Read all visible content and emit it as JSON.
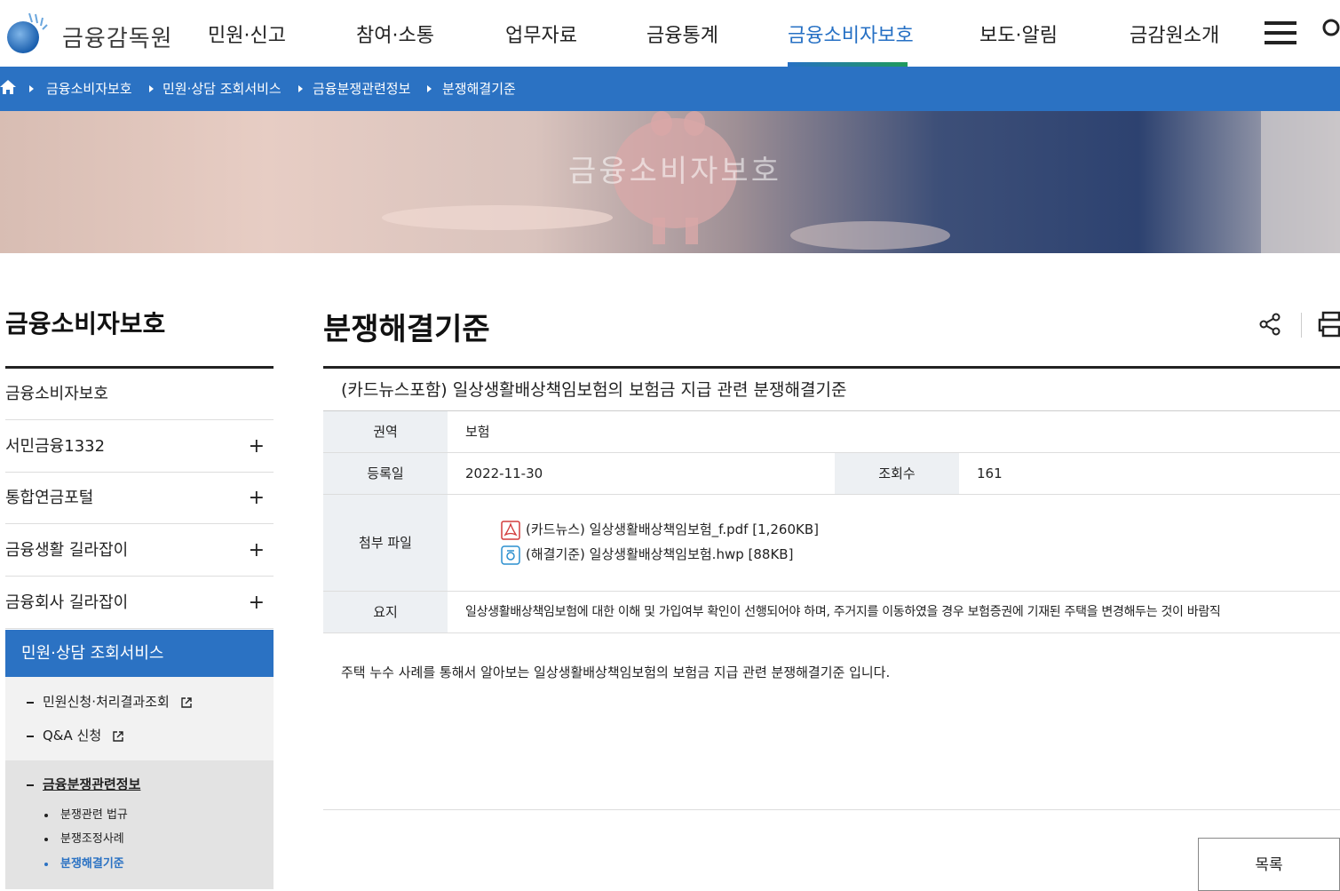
{
  "header": {
    "logo_text": "금융감독원",
    "nav": [
      "민원·신고",
      "참여·소통",
      "업무자료",
      "금융통계",
      "금융소비자보호",
      "보도·알림",
      "금감원소개"
    ],
    "active_nav": "금융소비자보호",
    "accent_color": "#2b72c3"
  },
  "breadcrumb": [
    "금융소비자보호",
    "민원·상담 조회서비스",
    "금융분쟁관련정보",
    "분쟁해결기준"
  ],
  "banner": {
    "title": "금융소비자보호"
  },
  "lnb": {
    "title": "금융소비자보호",
    "items": [
      {
        "label": "금융소비자보호",
        "expand": ""
      },
      {
        "label": "서민금융1332",
        "expand": "+"
      },
      {
        "label": "통합연금포털",
        "expand": "+"
      },
      {
        "label": "금융생활 길라잡이",
        "expand": "+"
      },
      {
        "label": "금융회사 길라잡이",
        "expand": "+"
      }
    ],
    "active": "민원·상담 조회서비스",
    "sub_links": [
      "민원신청·처리결과조회",
      "Q&A 신청"
    ],
    "sub_section": "금융분쟁관련정보",
    "sub_section_items": [
      "분쟁관련 법규",
      "분쟁조정사례",
      "분쟁해결기준"
    ],
    "current_item": "분쟁해결기준"
  },
  "content": {
    "page_title": "분쟁해결기준",
    "post_title": "(카드뉴스포함) 일상생활배상책임보험의 보험금 지급 관련 분쟁해결기준",
    "labels": {
      "category": "권역",
      "date": "등록일",
      "views": "조회수",
      "attachments": "첨부 파일",
      "summary": "요지"
    },
    "category": "보험",
    "date": "2022-11-30",
    "views": "161",
    "files": [
      {
        "name": "(카드뉴스) 일상생활배상책임보험_f.pdf [1,260KB]",
        "icon": "pdf-icon"
      },
      {
        "name": "(해결기준) 일상생활배상책임보험.hwp [88KB]",
        "icon": "hwp-icon"
      }
    ],
    "summary": "일상생활배상책임보험에 대한 이해 및 가입여부 확인이 선행되어야 하며, 주거지를 이동하였을 경우 보험증권에 기재된 주택을 변경해두는 것이 바람직",
    "body": "주택 누수 사례를 통해서 알아보는 일상생활배상책임보험의 보험금 지급 관련 분쟁해결기준 입니다.",
    "list_button": "목록"
  }
}
